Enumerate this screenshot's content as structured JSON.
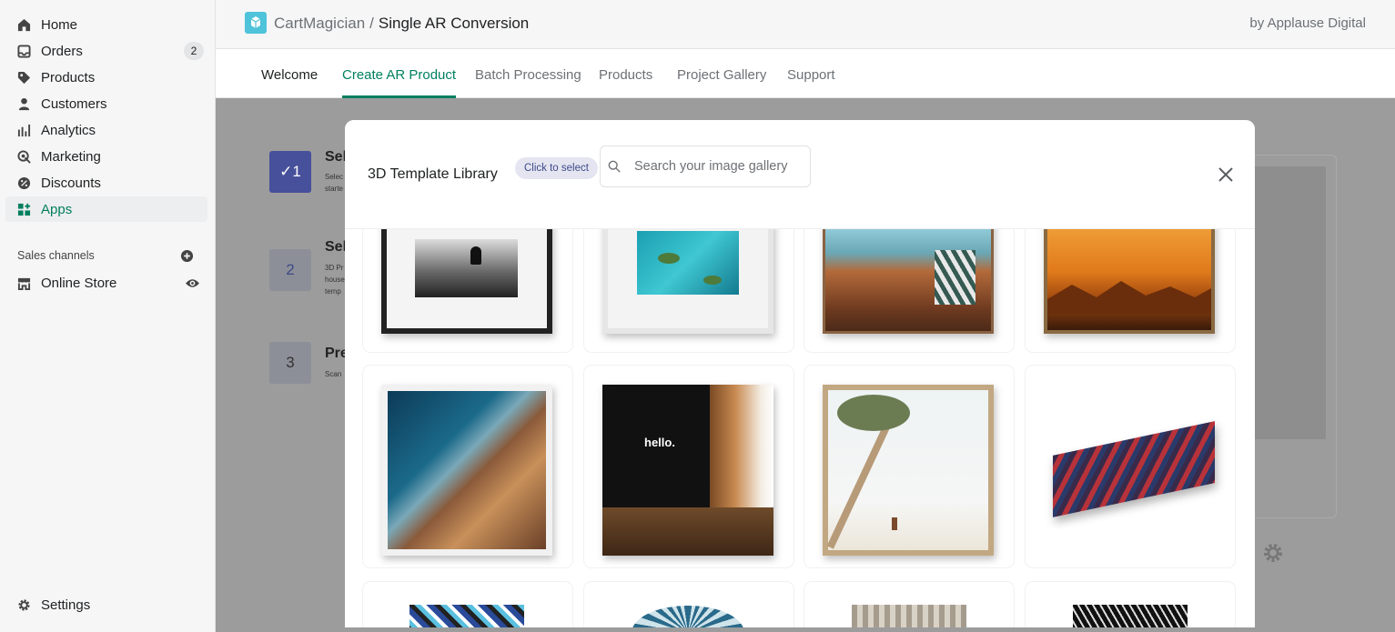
{
  "sidebar": {
    "items": [
      {
        "label": "Home",
        "icon": "home-icon"
      },
      {
        "label": "Orders",
        "icon": "orders-icon",
        "badge": "2"
      },
      {
        "label": "Products",
        "icon": "tag-icon"
      },
      {
        "label": "Customers",
        "icon": "person-icon"
      },
      {
        "label": "Analytics",
        "icon": "bar-chart-icon"
      },
      {
        "label": "Marketing",
        "icon": "marketing-icon"
      },
      {
        "label": "Discounts",
        "icon": "discount-icon"
      },
      {
        "label": "Apps",
        "icon": "apps-icon",
        "active": true
      }
    ],
    "sales_channels_header": "Sales channels",
    "online_store": "Online Store",
    "settings": "Settings"
  },
  "topbar": {
    "app_name": "CartMagician",
    "separator": "/",
    "page": "Single AR Conversion",
    "by": "by Applause Digital"
  },
  "tabs": [
    "Welcome",
    "Create AR Product",
    "Batch Processing",
    "Products",
    "Project Gallery",
    "Support"
  ],
  "steps": [
    {
      "num": "1",
      "title": "Sel",
      "desc": "Selec starte",
      "check": "✓"
    },
    {
      "num": "2",
      "title": "Sel",
      "desc": "3D Pr house temp"
    },
    {
      "num": "3",
      "title": "Pre",
      "desc": "Scan"
    }
  ],
  "modal": {
    "title": "3D Template Library",
    "pill": "Click to select",
    "search_placeholder": "Search your image gallery"
  },
  "gallery": {
    "hello_caption": "hello."
  },
  "colors": {
    "accent": "#008060",
    "step_active": "#47509a",
    "overlay": "#9c9c9c"
  }
}
